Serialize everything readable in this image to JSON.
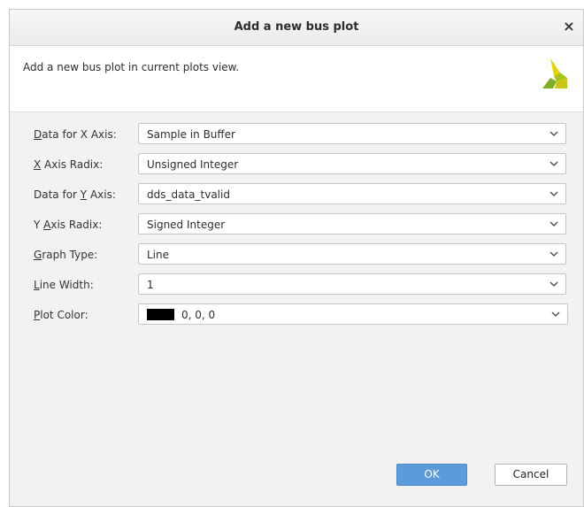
{
  "dialog": {
    "title": "Add a new bus plot",
    "close_label": "×",
    "description": "Add a new bus plot in current plots view."
  },
  "fields": [
    {
      "label_pre": "",
      "label_mnemonic": "D",
      "label_post": "ata for X Axis:",
      "value": "Sample in Buffer"
    },
    {
      "label_pre": "",
      "label_mnemonic": "X",
      "label_post": " Axis Radix:",
      "value": "Unsigned Integer"
    },
    {
      "label_pre": "Data for ",
      "label_mnemonic": "Y",
      "label_post": " Axis:",
      "value": "dds_data_tvalid"
    },
    {
      "label_pre": "Y ",
      "label_mnemonic": "A",
      "label_post": "xis Radix:",
      "value": "Signed Integer"
    },
    {
      "label_pre": "",
      "label_mnemonic": "G",
      "label_post": "raph Type:",
      "value": "Line"
    },
    {
      "label_pre": "",
      "label_mnemonic": "L",
      "label_post": "ine Width:",
      "value": "1"
    },
    {
      "label_pre": "",
      "label_mnemonic": "P",
      "label_post": "lot Color:",
      "value": "0, 0, 0",
      "swatch_color": "#000000"
    }
  ],
  "buttons": {
    "ok_label": "OK",
    "cancel_label": "Cancel"
  },
  "colors": {
    "ok_button": "#5b9bdc",
    "logo_yellow": "#e7d400",
    "logo_green": "#7cae26"
  },
  "icons": {
    "close": "close-icon",
    "logo": "vivado-logo-icon",
    "dropdown": "chevron-down-icon"
  }
}
